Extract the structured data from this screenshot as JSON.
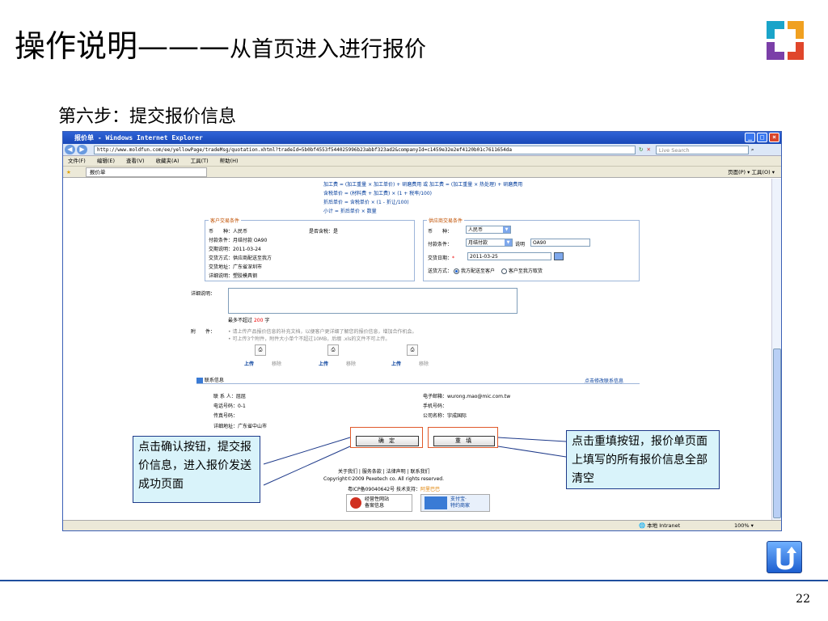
{
  "slide": {
    "title_main": "操作说明",
    "title_dash": "———",
    "title_sub": "从首页进入进行报价",
    "step": "第六步：提交报价信息",
    "page_number": "22"
  },
  "browser": {
    "window_title": "报价单 - Windows Internet Explorer",
    "url": "http://www.moldfun.com/ee/yellowPage/tradeMsg/quotation.xhtml?tradeId=5b0bf4553f544025996b23abbf323ad2&companyId=c1459e32e2ef4120b01c7611654da",
    "search_placeholder": "Live Search",
    "menu": [
      "文件(F)",
      "编辑(E)",
      "查看(V)",
      "收藏夹(A)",
      "工具(T)",
      "帮助(H)"
    ],
    "tab_label": "报价单",
    "cmdbar": "页面(P) ▾  工具(O) ▾",
    "status_zone": "本地 Intranet",
    "zoom": "100%"
  },
  "form": {
    "formulas": [
      "加工费 = (加工重量 × 加工单价) + 研磨费用 或 加工费 = (加工重量 × 热处理) + 研磨费用",
      "含税单价 = (材料费 + 加工费) × (1 + 税率/100)",
      "折后单价 = 含税单价 × (1 - 折让/100)",
      "小计 = 折后单价 × 数量"
    ],
    "customer_legend": "客户交易条件",
    "customer": {
      "currency": "币　　种：人民币",
      "tax": "是否含税：是",
      "payment": "付款条件：月结付款 OA90",
      "delivery_date": "交期说明：2011-03-24",
      "shipping": "交货方式：供应商配送至我方",
      "address": "交货地址：广东省深圳市",
      "detail": "详细说明：塑胶模具钢"
    },
    "supplier_legend": "供应商交易条件",
    "supplier": {
      "currency_label": "币　　种：",
      "currency_value": "人民币",
      "payment_label": "付款条件：",
      "payment_value": "月结付款",
      "payment_note_label": "说明",
      "payment_note_value": "OA90",
      "date_label": "交货日期：",
      "date_value": "2011-03-25",
      "shipping_label": "送货方式：",
      "shipping_option1": "我方配送至客户",
      "shipping_option2": "客户至我方取货"
    },
    "detail_label": "详细说明：",
    "max_label": "最多不超过",
    "max_count": "200",
    "max_unit": "字",
    "attach_label": "附　　件：",
    "attach_note1": "• 请上传产品报价信息的补充文档，以便客户更详细了解您的报价信息，增加合作机会。",
    "attach_note2": "• 可上传3个附件，附件大小单个不超过10MB，后缀 .xls的文件不可上传。",
    "upload": "上传",
    "remove": "移除",
    "contact_header": "联系信息",
    "contact_edit": "点击修改联系信息",
    "contact": {
      "name": "联 系 人：屈屈",
      "email": "电子邮箱：wurong.mao@mic.com.tw",
      "phone": "电话号码：0-1",
      "mobile": "手机号码：",
      "fax": "传真号码：",
      "company": "公司名称：宇成国际",
      "address": "详细地址：广东省中山市"
    },
    "confirm_button": "确 定",
    "reset_button": "重 填",
    "footer_links": "关于我们 | 服务条款 | 法律声明 | 联系我们",
    "copyright": "Copyright©2009 Pexetech co. All rights reserved.",
    "icp": "粤ICP备09040642号 技术支持：",
    "tech_support": "阿里巴巴",
    "badge1_line1": "经营性网站",
    "badge1_line2": "备案信息",
    "badge2_line1": "支付宝·",
    "badge2_line2": "特约商家"
  },
  "callouts": {
    "left": "点击确认按钮，提交报价信息，进入报价发送成功页面",
    "right": "点击重填按钮，报价单页面上填写的所有报价信息全部清空"
  },
  "colors": {
    "accent": "#1f4e9e",
    "callout_bg": "#d9f3fa",
    "highlight": "#e05a2a"
  }
}
